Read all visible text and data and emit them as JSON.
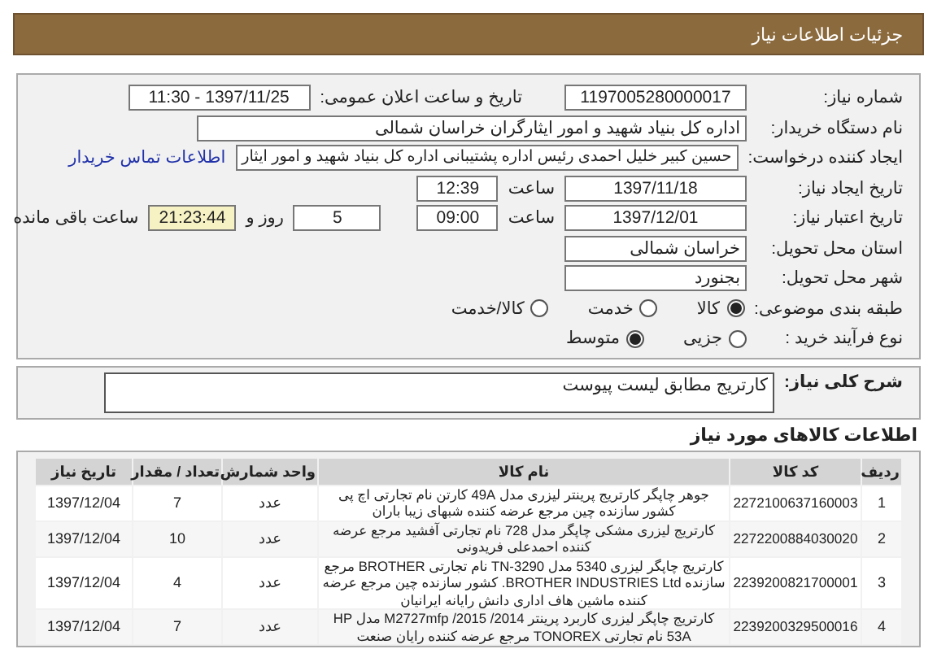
{
  "header": {
    "title": "جزئیات اطلاعات نیاز"
  },
  "need_number": {
    "label": "شماره نیاز:",
    "value": "1197005280000017"
  },
  "announce": {
    "label": "تاریخ و ساعت اعلان عمومی:",
    "value": "1397/11/25 - 11:30"
  },
  "buyer": {
    "label": "نام دستگاه خریدار:",
    "value": "اداره کل بنیاد شهید و امور ایثارگران خراسان شمالی"
  },
  "creator": {
    "label": "ایجاد کننده درخواست:",
    "value": "حسین کبیر خلیل احمدی رئیس اداره پشتیبانی  اداره کل بنیاد شهید و امور ایثار",
    "link": "اطلاعات تماس خریدار"
  },
  "creation": {
    "label": "تاریخ ایجاد نیاز:",
    "date": "1397/11/18",
    "time_label": "ساعت",
    "time": "12:39"
  },
  "validity": {
    "label": "تاریخ اعتبار نیاز:",
    "date": "1397/12/01",
    "time_label": "ساعت",
    "time": "09:00",
    "days": "5",
    "days_label": "روز و",
    "remaining": "21:23:44",
    "remaining_label": "ساعت باقی مانده"
  },
  "province": {
    "label": "استان محل تحویل:",
    "value": "خراسان شمالی"
  },
  "city": {
    "label": "شهر محل تحویل:",
    "value": "بجنورد"
  },
  "category": {
    "label": "طبقه بندی موضوعی:",
    "options": [
      {
        "label": "کالا",
        "selected": true
      },
      {
        "label": "خدمت",
        "selected": false
      },
      {
        "label": "کالا/خدمت",
        "selected": false
      }
    ]
  },
  "process": {
    "label": "نوع فرآیند خرید :",
    "options": [
      {
        "label": "جزیی",
        "selected": false
      },
      {
        "label": "متوسط",
        "selected": true
      }
    ]
  },
  "description": {
    "label": "شرح کلی نیاز:",
    "value": "کارتریج مطابق لیست پیوست"
  },
  "goods": {
    "title": "اطلاعات کالاهای مورد نیاز",
    "columns": [
      "ردیف",
      "کد کالا",
      "نام کالا",
      "واحد شمارش",
      "تعداد / مقدار",
      "تاریخ نیاز"
    ],
    "rows": [
      [
        "1",
        "2272100637160003",
        "جوهر چاپگر کارتریج پرینتر لیزری مدل 49A کارتن نام تجارتی اچ پی کشور سازنده چین مرجع عرضه کننده شبهای زیبا باران",
        "عدد",
        "7",
        "1397/12/04"
      ],
      [
        "2",
        "2272200884030020",
        "کارتریج لیزری مشکی چاپگر مدل 728 نام تجارتی آفشید مرجع عرضه کننده احمدعلی فریدونی",
        "عدد",
        "10",
        "1397/12/04"
      ],
      [
        "3",
        "2239200821700001",
        "کارتریج چاپگر لیزری 5340 مدل TN-3290 نام تجارتی BROTHER مرجع سازنده BROTHER INDUSTRIES Ltd. کشور سازنده چین مرجع عرضه کننده ماشین هاف اداری دانش رایانه ایرانیان",
        "عدد",
        "4",
        "1397/12/04"
      ],
      [
        "4",
        "2239200329500016",
        "کارتریج چاپگر لیزری کاربرد پرینتر 2014/ 2015/ M2727mfp مدل HP 53A نام تجارتی TONOREX مرجع عرضه کننده رایان صنعت",
        "عدد",
        "7",
        "1397/12/04"
      ]
    ]
  }
}
